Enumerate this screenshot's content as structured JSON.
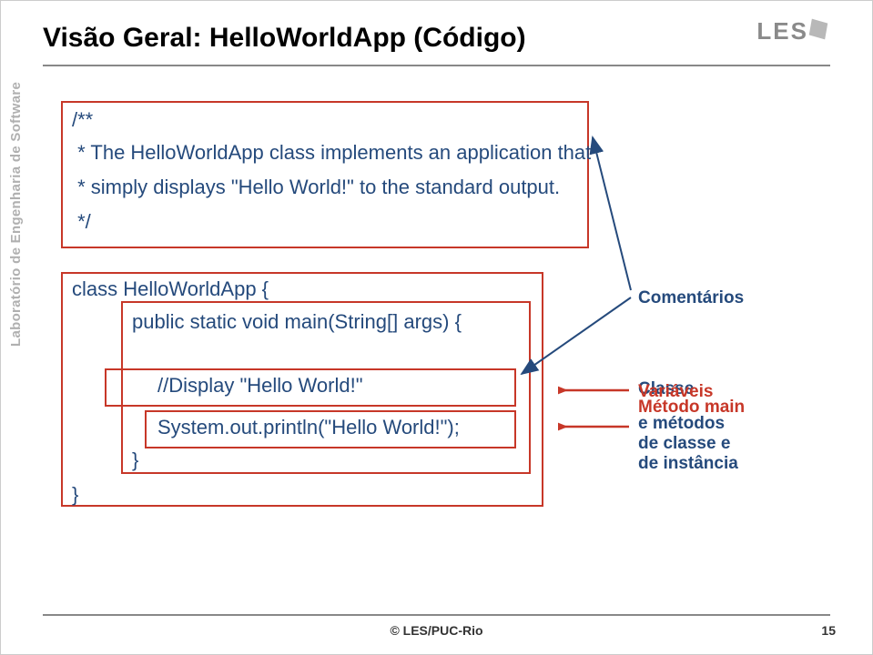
{
  "title": "Visão Geral: HelloWorldApp (Código)",
  "logo_text": "LES",
  "vertical_label": "Laboratório de Engenharia de Software",
  "code": {
    "l1": "/**",
    "l2": " * The HelloWorldApp class implements an application that",
    "l3": " * simply displays \"Hello World!\" to the standard output.",
    "l4": " */",
    "l5": "class HelloWorldApp {",
    "l6": "public static void main(String[] args) {",
    "l7": "//Display \"Hello World!\"",
    "l8": "System.out.println(\"Hello World!\");",
    "l9": "}",
    "l10": "}"
  },
  "annotations": {
    "comentarios": "Comentários",
    "classe": "Classe",
    "variaveis": "Variáveis",
    "metodo_main": "Método main",
    "e_metodos": "e métodos",
    "de_classe": "de classe e",
    "de_instancia": "de instância"
  },
  "footer": "© LES/PUC-Rio",
  "page_number": "15"
}
